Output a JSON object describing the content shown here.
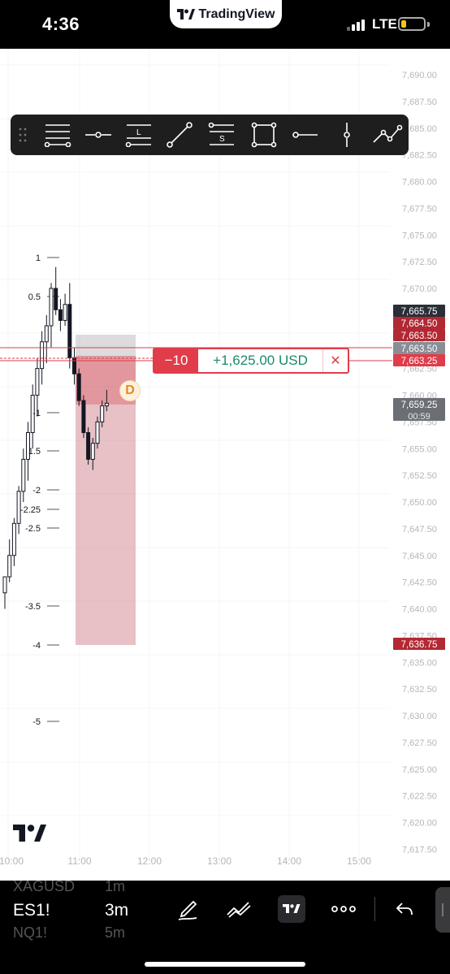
{
  "status_bar": {
    "time": "4:36",
    "app_label": "TradingView",
    "network": "LTE"
  },
  "drawing_toolbar": {
    "tools": [
      "drag-handle-icon",
      "horizontal-lines-icon",
      "horizontal-ray-icon",
      "long-position-icon",
      "trend-line-icon",
      "short-position-icon",
      "rectangle-icon",
      "ray-icon",
      "vertical-line-icon",
      "path-icon"
    ],
    "long_letter": "L",
    "short_letter": "S"
  },
  "price_axis": {
    "ticks": [
      "7,690.00",
      "7,687.50",
      "7,685.00",
      "7,682.50",
      "7,680.00",
      "7,677.50",
      "7,675.00",
      "7,672.50",
      "7,670.00",
      "7,667.50",
      "7,665.00",
      "7,662.50",
      "7,660.00",
      "7,657.50",
      "7,655.00",
      "7,652.50",
      "7,650.00",
      "7,647.50",
      "7,645.00",
      "7,642.50",
      "7,640.00",
      "7,637.50",
      "7,635.00",
      "7,632.50",
      "7,630.00",
      "7,627.50",
      "7,625.00",
      "7,622.50",
      "7,620.00",
      "7,617.50"
    ],
    "labels": [
      {
        "text": "7,665.75",
        "color": "#2a2e39"
      },
      {
        "text": "7,664.50",
        "color": "#b22833"
      },
      {
        "text": "7,663.50",
        "color": "#b22833"
      },
      {
        "text": "7,663.50",
        "color": "#8a8d96"
      },
      {
        "text": "7,663.25",
        "color": "#e03c4a"
      },
      {
        "text": "7,659.25",
        "color": "#6b6e75",
        "sub": "00:59"
      },
      {
        "text": "7,636.75",
        "color": "#b22833"
      }
    ]
  },
  "fib_levels": [
    "1",
    "0.5",
    "-1",
    "1.5",
    "-2",
    "-2.25",
    "-2.5",
    "-3.5",
    "-4",
    "-5"
  ],
  "time_axis": [
    "10:00",
    "11:00",
    "12:00",
    "13:00",
    "14:00",
    "15:00"
  ],
  "position": {
    "quantity": "−10",
    "pnl": "+1,625.00 USD",
    "close": "✕",
    "badge": "D"
  },
  "bottom_bar": {
    "symbols": {
      "prev": "XAGUSD",
      "current": "ES1!",
      "next": "NQ1!"
    },
    "timeframes": {
      "prev": "1m",
      "current": "3m",
      "next": "5m"
    },
    "icons": [
      "draw-pen-icon",
      "indicators-icon",
      "tradingview-logo-icon",
      "more-icon",
      "undo-icon"
    ]
  },
  "chart_data": {
    "type": "candlestick",
    "symbol": "ES1!",
    "interval": "3m",
    "ylim": [
      7616.5,
      7691.0
    ],
    "last_price": 7659.25,
    "position_entry": 7663.25,
    "stop_top": 7666.75,
    "stop_bottom": 7636.75,
    "candles": [
      {
        "o": 7641.5,
        "h": 7643.0,
        "l": 7640.0,
        "c": 7643.0
      },
      {
        "o": 7643.0,
        "h": 7646.5,
        "l": 7642.5,
        "c": 7645.0
      },
      {
        "o": 7645.0,
        "h": 7648.5,
        "l": 7644.0,
        "c": 7648.0
      },
      {
        "o": 7648.0,
        "h": 7651.5,
        "l": 7647.0,
        "c": 7651.0
      },
      {
        "o": 7651.0,
        "h": 7655.0,
        "l": 7650.0,
        "c": 7654.0
      },
      {
        "o": 7654.0,
        "h": 7657.5,
        "l": 7652.0,
        "c": 7656.5
      },
      {
        "o": 7656.5,
        "h": 7661.0,
        "l": 7655.0,
        "c": 7660.0
      },
      {
        "o": 7660.0,
        "h": 7663.5,
        "l": 7658.0,
        "c": 7662.5
      },
      {
        "o": 7662.5,
        "h": 7666.0,
        "l": 7661.0,
        "c": 7665.0
      },
      {
        "o": 7665.0,
        "h": 7667.5,
        "l": 7663.0,
        "c": 7666.5
      },
      {
        "o": 7666.5,
        "h": 7670.5,
        "l": 7664.5,
        "c": 7670.0
      },
      {
        "o": 7670.0,
        "h": 7672.0,
        "l": 7667.5,
        "c": 7668.0
      },
      {
        "o": 7668.0,
        "h": 7669.0,
        "l": 7666.0,
        "c": 7667.0
      },
      {
        "o": 7667.0,
        "h": 7669.5,
        "l": 7666.5,
        "c": 7668.5
      },
      {
        "o": 7668.5,
        "h": 7670.5,
        "l": 7662.5,
        "c": 7663.5
      },
      {
        "o": 7663.5,
        "h": 7664.5,
        "l": 7661.0,
        "c": 7662.0
      },
      {
        "o": 7662.0,
        "h": 7662.5,
        "l": 7659.0,
        "c": 7659.5
      },
      {
        "o": 7659.5,
        "h": 7660.0,
        "l": 7656.0,
        "c": 7656.5
      },
      {
        "o": 7656.5,
        "h": 7657.0,
        "l": 7653.5,
        "c": 7654.0
      },
      {
        "o": 7654.0,
        "h": 7656.0,
        "l": 7653.0,
        "c": 7655.5
      },
      {
        "o": 7655.5,
        "h": 7658.0,
        "l": 7655.0,
        "c": 7657.5
      },
      {
        "o": 7657.5,
        "h": 7659.5,
        "l": 7657.0,
        "c": 7659.0
      },
      {
        "o": 7659.0,
        "h": 7660.5,
        "l": 7658.5,
        "c": 7659.25
      }
    ]
  }
}
